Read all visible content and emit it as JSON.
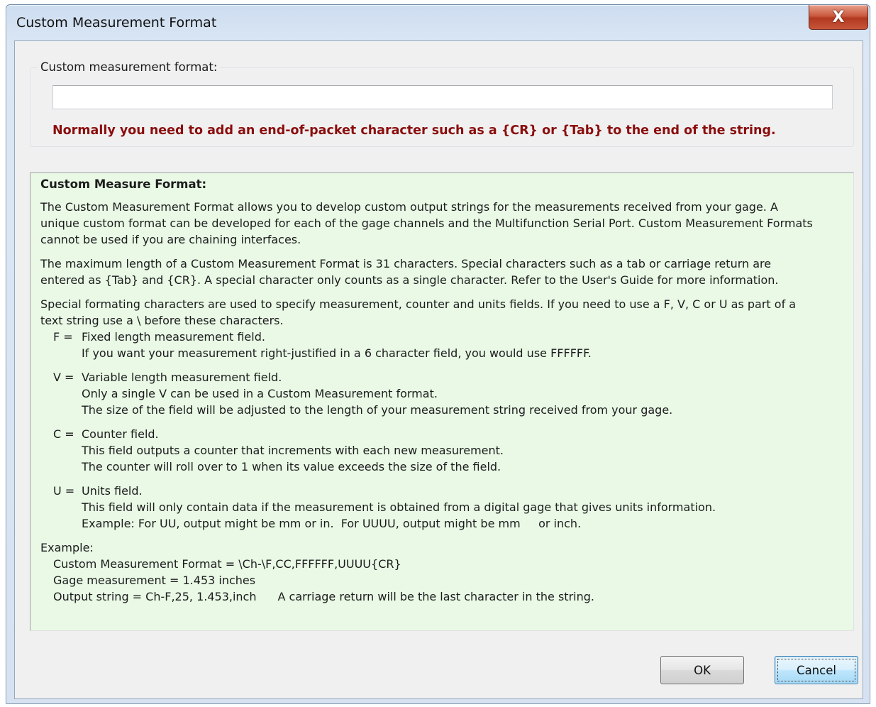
{
  "window": {
    "title": "Custom Measurement Format",
    "close_glyph": "X"
  },
  "format_group": {
    "legend": "Custom measurement format:",
    "input_value": "",
    "warning": "Normally you need to add an end-of-packet character such as a {CR} or {Tab} to the end of the string."
  },
  "help": {
    "heading": "Custom Measure Format:",
    "intro_lines": [
      "The Custom Measurement Format allows you to develop custom output strings for the measurements received from your gage.  A",
      "unique custom format can be developed for each of the gage channels and the Multifunction Serial Port.  Custom Measurement Formats",
      "cannot be used if you are chaining interfaces."
    ],
    "length_lines": [
      "The maximum length of a Custom Measurement Format is 31 characters.  Special characters such as a tab or carriage return are",
      "entered as {Tab} and {CR}.  A special character only counts as a single character.  Refer to the User's Guide for more information."
    ],
    "special_lines": [
      "Special formating characters are used to specify measurement, counter and units fields.  If you need to use a F, V, C or U as part of a",
      "text string use a \\ before these characters."
    ],
    "fields": [
      {
        "key": "F =",
        "lines": [
          "Fixed length measurement field.",
          "If you want your measurement right-justified in a 6 character field, you would use FFFFFF."
        ]
      },
      {
        "key": "V =",
        "lines": [
          "Variable length measurement field.",
          "Only a single V can be used in a Custom Measurement format.",
          "The size of the field will be adjusted to the length of your measurement string received from your gage."
        ]
      },
      {
        "key": "C =",
        "lines": [
          "Counter field.",
          "This field outputs a counter that increments with each new measurement.",
          "The counter will roll over to 1 when its value exceeds the size of the field."
        ]
      },
      {
        "key": "U =",
        "lines": [
          "Units field.",
          "This field will only contain data if the measurement is obtained from a digital gage that gives units information.",
          "Example: For UU, output might be mm or in.  For UUUU, output might be mm     or inch."
        ]
      }
    ],
    "example_label": "Example:",
    "example_format": "Custom Measurement Format = \\Ch-\\F,CC,FFFFFF,UUUU{CR}",
    "example_gage": "Gage measurement = 1.453 inches",
    "example_output": "Output string = Ch-F,25, 1.453,inch",
    "example_note": "A carriage return will be the last character in the string."
  },
  "buttons": {
    "ok": "OK",
    "cancel": "Cancel"
  }
}
